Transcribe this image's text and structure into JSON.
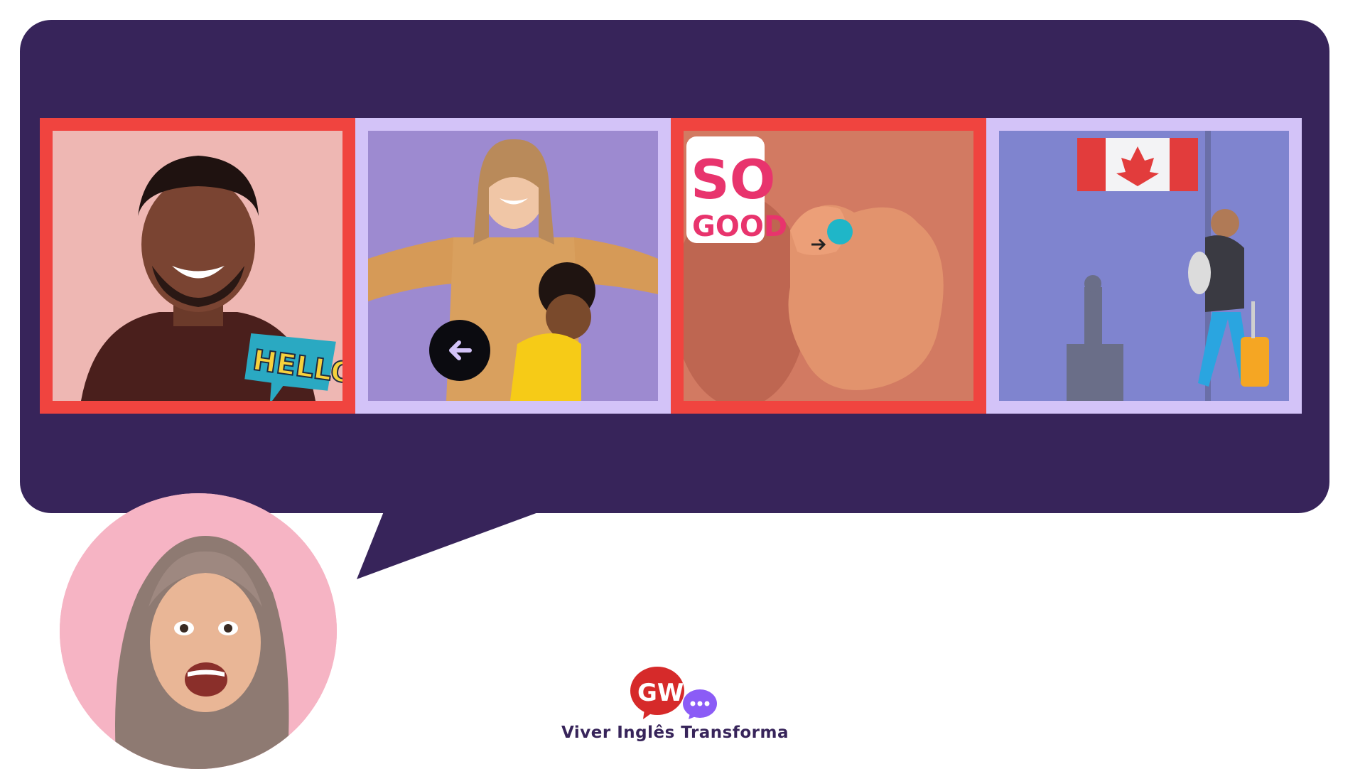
{
  "cards": [
    {
      "name": "hello",
      "sticker": "HELLO",
      "active": true
    },
    {
      "name": "welcome",
      "active": false
    },
    {
      "name": "so-good",
      "sticker_top": "SO",
      "sticker_bottom": "GOOD",
      "active": true
    },
    {
      "name": "travel-canada",
      "active": false
    }
  ],
  "back_button": {
    "icon": "arrow-left-icon"
  },
  "brand": {
    "logo_text": "GW",
    "caption": "Viver Inglês Transforma"
  },
  "colors": {
    "bubble": "#37245a",
    "card_border_active": "#f0443f",
    "card_border_idle": "#d3c3f8",
    "avatar_bg": "#f6b4c4",
    "brand_red": "#d62a2a",
    "brand_purple": "#8b5cf6"
  }
}
